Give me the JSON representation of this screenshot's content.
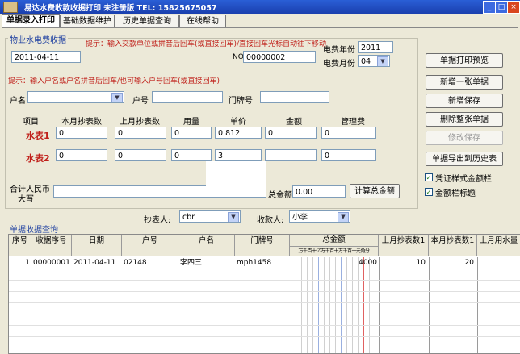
{
  "window": {
    "title": "易达水费收款收据打印  未注册版    TEL: 15825675057",
    "min_label": "_",
    "max_label": "□",
    "close_label": "×"
  },
  "tabs": [
    {
      "label": "单据录入打印",
      "active": true
    },
    {
      "label": "基础数据维护"
    },
    {
      "label": "历史单据查询"
    },
    {
      "label": "在线帮助"
    }
  ],
  "form": {
    "group_title": "物业水电费收据",
    "hint_top": "提示：输入交款单位或拼音后回车(或直接回车)/直接回车光标自动往下移动",
    "date_value": "2011-04-11",
    "no_label": "NO",
    "no_value": "00000002",
    "year_label": "电费年份",
    "year_value": "2011",
    "month_label": "电费月份",
    "month_value": "04",
    "hint_mid": "提示：输入户名或户名拼音后回车/也可输入户号回车(或直接回车)",
    "name_label": "户名",
    "account_label": "户号",
    "door_label": "门牌号",
    "columns": {
      "item": "项目",
      "this_reading": "本月抄表数",
      "last_reading": "上月抄表数",
      "usage": "用量",
      "price": "单价",
      "amount": "金额",
      "mgmt_fee": "管理费"
    },
    "meter1_label": "水表1",
    "meter1": {
      "this_reading": "0",
      "last_reading": "0",
      "usage": "0",
      "price": "0.812",
      "amount": "0",
      "mgmt_fee": "0"
    },
    "meter2_label": "水表2",
    "meter2": {
      "this_reading": "0",
      "last_reading": "0",
      "usage": "0",
      "price": "3",
      "amount": "",
      "mgmt_fee": "0"
    },
    "total_words_label_1": "合计人民币",
    "total_words_label_2": "大写",
    "total_label": "总金额",
    "total_value": "0.00",
    "calc_button": "计算总金额",
    "reader_label": "抄表人:",
    "reader_value": "cbr",
    "collector_label": "收款人:",
    "collector_value": "小李"
  },
  "actions": {
    "print_preview": "单据打印预览",
    "new_receipt": "新增一张单据",
    "save_new": "新增保存",
    "delete_receipt": "删除整张单据",
    "modify_save": "修改保存",
    "export_history": "单据导出到历史表",
    "chk_voucher_label": "凭证样式金额栏",
    "chk_amount_label": "金额栏标题"
  },
  "grid": {
    "title": "单据收据查询",
    "headers": [
      "序号",
      "收据序号",
      "日期",
      "户号",
      "户名",
      "门牌号",
      "总金额",
      "上月抄表数1",
      "本月抄表数1",
      "上月用水量"
    ],
    "digit_header": "万千百十亿万千百十万千百十元角分",
    "rows": [
      {
        "seq": "1",
        "receipt_no": "00000001",
        "date": "2011-04-11",
        "account": "02148",
        "name": "李四三",
        "door": "mph1458",
        "total": "4000",
        "last1": "10",
        "this1": "20"
      }
    ]
  }
}
